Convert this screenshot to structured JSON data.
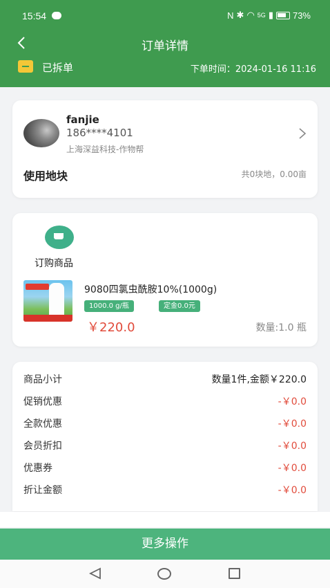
{
  "status_bar": {
    "time": "15:54",
    "battery": "73%",
    "network": "5G"
  },
  "header": {
    "title": "订单详情",
    "order_status": "已拆单",
    "order_time": "下单时间：2024-01-16 11:16"
  },
  "user": {
    "name": "fanjie",
    "phone": "186****4101",
    "company": "上海深益科技-作物帮",
    "land_label": "使用地块",
    "land_summary": "共0块地，0.00亩"
  },
  "goods": {
    "section_label": "订购商品",
    "product_name": "9080四氯虫酰胺10%(1000g)",
    "spec": "1000.0 g/瓶",
    "deposit": "定金0.0元",
    "price": "￥220.0",
    "quantity": "数量:1.0 瓶"
  },
  "summary": {
    "rows": [
      {
        "label": "商品小计",
        "value": "数量1件,金额￥220.0"
      },
      {
        "label": "促销优惠",
        "value": "-￥0.0"
      },
      {
        "label": "全款优惠",
        "value": "-￥0.0"
      },
      {
        "label": "会员折扣",
        "value": "-￥0.0"
      },
      {
        "label": "优惠券",
        "value": "-￥0.0"
      },
      {
        "label": "折让金额",
        "value": "-￥0.0"
      }
    ]
  },
  "actions": {
    "more_label": "更多操作"
  },
  "colors": {
    "header_green": "#3f9b4f",
    "button_green": "#4db47d",
    "price_red": "#e14b3b",
    "chip_green": "#46b07a"
  },
  "icons": [
    "back-icon",
    "chevron-right-icon",
    "goods-bag-icon",
    "order-status-icon",
    "nav-back-icon",
    "nav-home-icon",
    "nav-recent-icon"
  ]
}
